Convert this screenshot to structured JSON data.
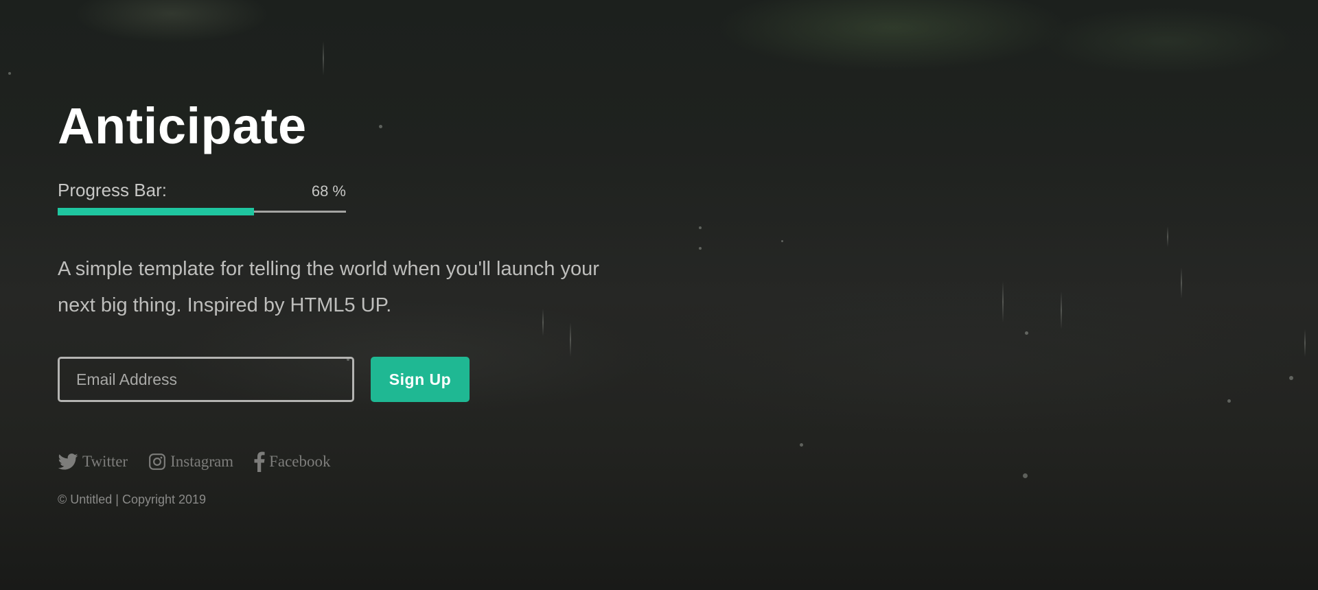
{
  "page": {
    "title": "Anticipate"
  },
  "progress": {
    "label": "Progress Bar:",
    "value_text": "68 %",
    "fraction": 0.68,
    "fill_color": "#1fc6a0"
  },
  "description": "A simple template for telling the world when you'll launch your next big thing. Inspired by HTML5 UP.",
  "signup": {
    "email_placeholder": "Email Address",
    "button_label": "Sign Up",
    "button_color": "#1fb893"
  },
  "social": [
    {
      "label": "Twitter",
      "icon": "twitter-icon"
    },
    {
      "label": "Instagram",
      "icon": "instagram-icon"
    },
    {
      "label": "Facebook",
      "icon": "facebook-icon"
    }
  ],
  "footer": {
    "copyright": "© Untitled | Copyright 2019"
  }
}
